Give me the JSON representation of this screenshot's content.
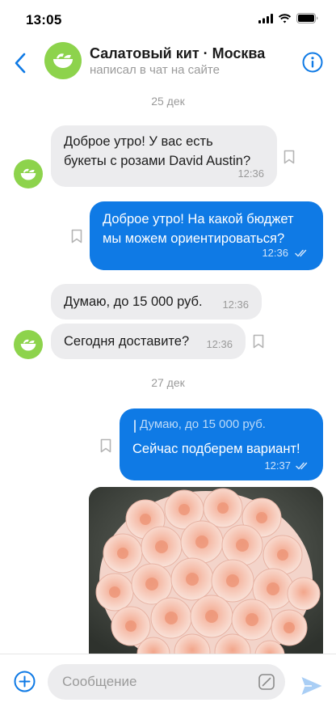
{
  "status_bar": {
    "time": "13:05",
    "icons": [
      "signal-icon",
      "wifi-icon",
      "battery-icon"
    ]
  },
  "header": {
    "back_icon": "chevron-left-icon",
    "title": "Салатовый кит · Москва",
    "subtitle": "написал в чат на сайте",
    "info_icon": "info-icon"
  },
  "colors": {
    "accent": "#0f7ae5",
    "avatar": "#8dd34c",
    "incoming_bubble": "#ececee",
    "muted_text": "#9a9a9a"
  },
  "chat": {
    "dates": [
      "25 дек",
      "27 дек"
    ],
    "messages": [
      {
        "direction": "in",
        "lines": [
          "Доброе утро! У вас есть",
          "букеты с розами David Austin?"
        ],
        "time": "12:36"
      },
      {
        "direction": "out",
        "lines": [
          "Доброе утро! На какой бюджет",
          "мы можем ориентироваться?"
        ],
        "time": "12:36",
        "status": "read"
      },
      {
        "direction": "in",
        "lines": [
          "Думаю, до 15 000 руб."
        ],
        "time": "12:36"
      },
      {
        "direction": "in",
        "lines": [
          "Сегодня доставите?"
        ],
        "time": "12:36"
      },
      {
        "direction": "out",
        "reply_to": "Думаю, до 15 000 руб.",
        "lines": [
          "Сейчас подберем вариант!"
        ],
        "time": "12:37",
        "status": "read"
      },
      {
        "direction": "out",
        "type": "photo",
        "subject": "bouquet of peach-pink roses"
      }
    ]
  },
  "composer": {
    "placeholder": "Сообщение",
    "value": "",
    "add_icon": "plus-circle-icon",
    "sticker_icon": "sticker-icon",
    "send_icon": "send-icon"
  }
}
